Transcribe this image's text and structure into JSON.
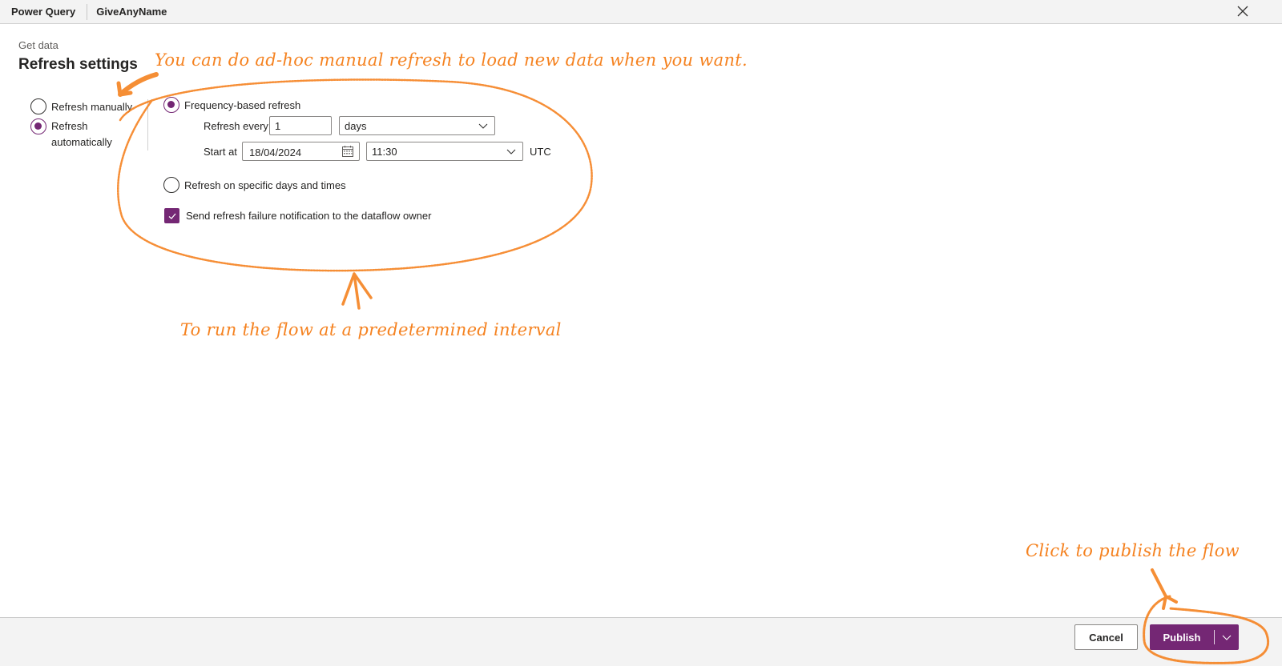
{
  "topbar": {
    "app_name": "Power Query",
    "document_name": "GiveAnyName",
    "close_icon": "close-icon"
  },
  "header": {
    "breadcrumb": "Get data",
    "title": "Refresh settings"
  },
  "refresh_mode": {
    "options": [
      {
        "label": "Refresh manually",
        "checked": false
      },
      {
        "label": "Refresh automatically",
        "checked": true
      }
    ]
  },
  "automatic": {
    "frequency_option": {
      "label": "Frequency-based refresh",
      "checked": true
    },
    "refresh_every_label": "Refresh every",
    "refresh_every_value": "1",
    "refresh_unit": "days",
    "start_at_label": "Start at",
    "start_date": "18/04/2024",
    "start_time": "11:30",
    "timezone": "UTC",
    "specific_option": {
      "label": "Refresh on specific days and times",
      "checked": false
    },
    "notification": {
      "label": "Send refresh failure notification to the dataflow owner",
      "checked": true
    }
  },
  "footer": {
    "cancel_label": "Cancel",
    "publish_label": "Publish"
  },
  "annotations": {
    "manual_note": "You can do ad-hoc manual refresh to load new data when you want.",
    "interval_note": "To run the flow at a predetermined interval",
    "publish_note": "Click to publish the flow",
    "color": "#f58220"
  },
  "colors": {
    "accent": "#742774",
    "topbar_bg": "#f3f3f3",
    "footer_bg": "#f3f3f3"
  }
}
